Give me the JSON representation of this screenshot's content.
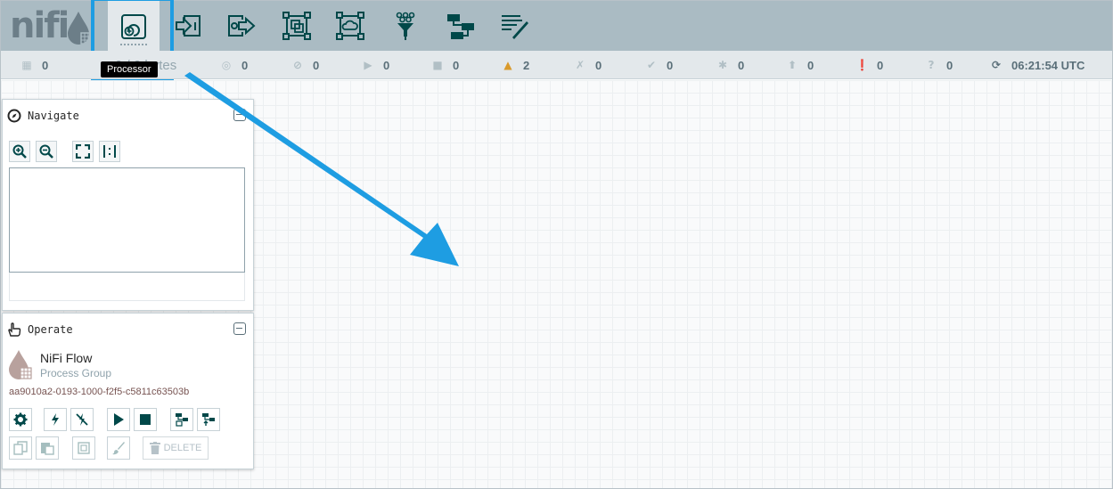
{
  "app": {
    "logo_text": "nifi"
  },
  "toolbar": {
    "buttons": [
      {
        "name": "processor",
        "icon": "processor-icon"
      },
      {
        "name": "input-port",
        "icon": "input-port-icon"
      },
      {
        "name": "output-port",
        "icon": "output-port-icon"
      },
      {
        "name": "process-group",
        "icon": "process-group-icon"
      },
      {
        "name": "remote-process-group",
        "icon": "remote-process-group-icon"
      },
      {
        "name": "funnel",
        "icon": "funnel-icon"
      },
      {
        "name": "template",
        "icon": "template-icon"
      },
      {
        "name": "label",
        "icon": "label-icon"
      }
    ],
    "tooltip": "Processor",
    "highlight_color": "#1e9de2"
  },
  "status": {
    "partial_text": "0 / 0 bytes",
    "cluster": "0",
    "transmitting": "0",
    "not_transmitting": "0",
    "running": "0",
    "stopped": "0",
    "invalid": "2",
    "disabled": "0",
    "up_to_date": "0",
    "locally_modified": "0",
    "stale": "0",
    "locally_modified_stale": "0",
    "sync_failure": "0",
    "refresh_time": "06:21:54 UTC",
    "warning_color": "#d99a2c"
  },
  "navigate": {
    "title": "Navigate"
  },
  "operate": {
    "title": "Operate",
    "group_name": "NiFi Flow",
    "group_type": "Process Group",
    "group_id": "aa9010a2-0193-1000-f2f5-c5811c63503b",
    "delete_label": "DELETE"
  }
}
